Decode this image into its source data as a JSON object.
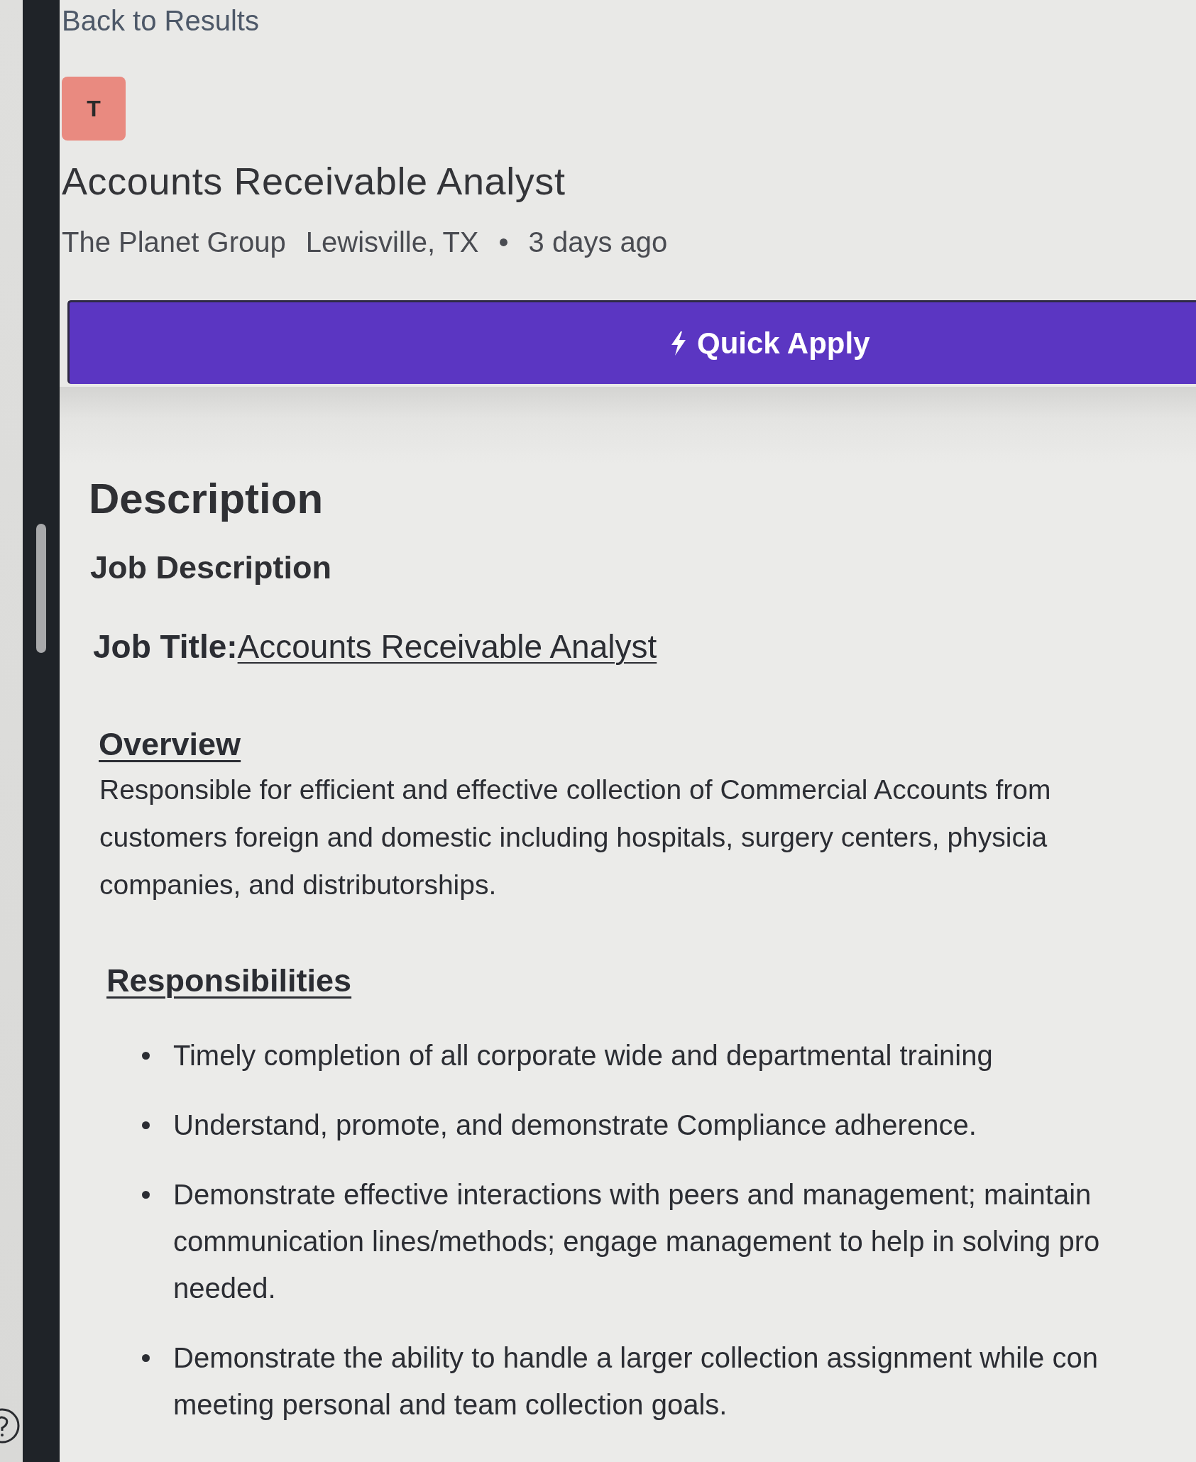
{
  "back_link": "Back to Results",
  "company_logo": {
    "letter": "T"
  },
  "job": {
    "title": "Accounts Receivable Analyst",
    "company": "The Planet Group",
    "location": "Lewisville, TX",
    "separator": "•",
    "posted": "3 days ago"
  },
  "quick_apply": {
    "label": "Quick Apply"
  },
  "description": {
    "heading": "Description",
    "subheading": "Job Description",
    "job_title": {
      "label": "Job Title:",
      "value": "Accounts Receivable Analyst"
    },
    "sections": [
      {
        "kind": "paragraph",
        "heading": "Overview",
        "lines": [
          "Responsible for efficient and effective collection of Commercial Accounts from",
          "customers foreign and domestic including hospitals, surgery centers, physicia",
          "companies, and distributorships."
        ]
      },
      {
        "kind": "bullets",
        "heading": "Responsibilities",
        "items": [
          {
            "lines": [
              "Timely completion of all corporate wide and departmental training"
            ]
          },
          {
            "lines": [
              "Understand, promote, and demonstrate Compliance adherence."
            ]
          },
          {
            "lines": [
              "Demonstrate effective interactions with peers and management; maintain",
              "communication lines/methods; engage management to help in solving pro",
              "needed."
            ]
          },
          {
            "lines": [
              "Demonstrate the ability to handle a larger collection assignment while con",
              "meeting personal and team collection goals."
            ]
          }
        ]
      }
    ]
  }
}
